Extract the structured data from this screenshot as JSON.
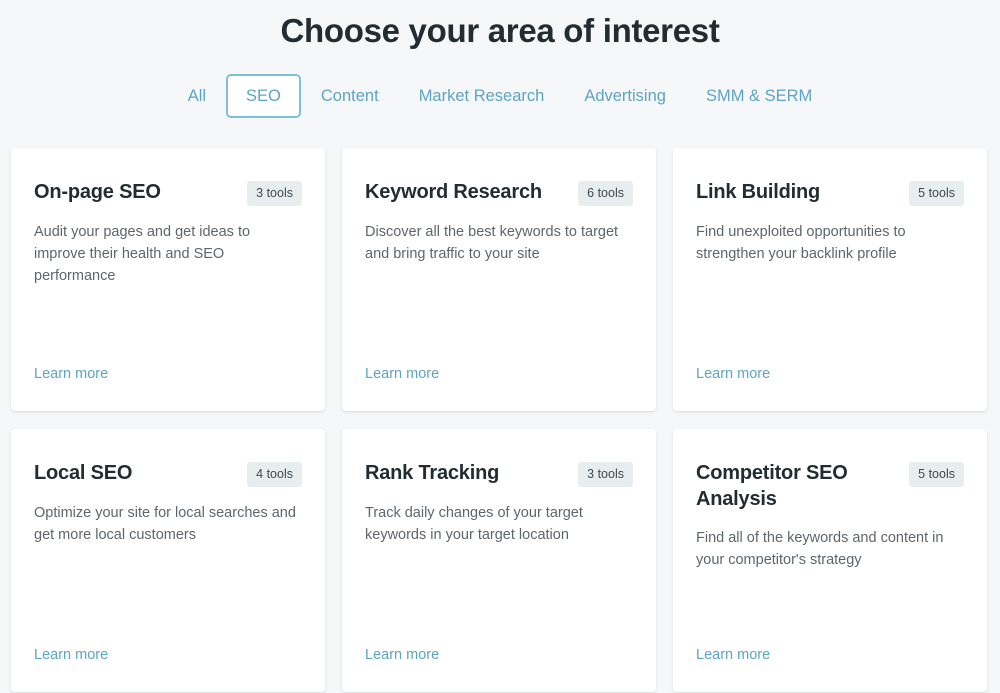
{
  "header": {
    "title": "Choose your area of interest"
  },
  "tabs": {
    "active": "SEO",
    "items": [
      {
        "label": "All",
        "active": false
      },
      {
        "label": "SEO",
        "active": true
      },
      {
        "label": "Content",
        "active": false
      },
      {
        "label": "Market Research",
        "active": false
      },
      {
        "label": "Advertising",
        "active": false
      },
      {
        "label": "SMM & SERM",
        "active": false
      }
    ]
  },
  "cards": [
    {
      "title": "On-page SEO",
      "badge": "3 tools",
      "description": "Audit your pages and get ideas to improve their health and SEO performance",
      "link": "Learn more"
    },
    {
      "title": "Keyword Research",
      "badge": "6 tools",
      "description": "Discover all the best keywords to target and bring traffic to your site",
      "link": "Learn more"
    },
    {
      "title": "Link Building",
      "badge": "5 tools",
      "description": "Find unexploited opportunities to strengthen your backlink profile",
      "link": "Learn more"
    },
    {
      "title": "Local SEO",
      "badge": "4 tools",
      "description": "Optimize your site for local searches and get more local customers",
      "link": "Learn more"
    },
    {
      "title": "Rank Tracking",
      "badge": "3 tools",
      "description": "Track daily changes of your target keywords in your target location",
      "link": "Learn more"
    },
    {
      "title": "Competitor SEO Analysis",
      "badge": "5 tools",
      "description": "Find all of the keywords and content in your competitor's strategy",
      "link": "Learn more"
    }
  ],
  "colors": {
    "page_background": "#f6f7f8",
    "card_background": "#ffffff",
    "title_text": "#222c31",
    "body_text": "#5d666c",
    "accent_blue": "#5da4c4",
    "tab_border": "#7cc0d8",
    "badge_background": "#e8edef"
  }
}
